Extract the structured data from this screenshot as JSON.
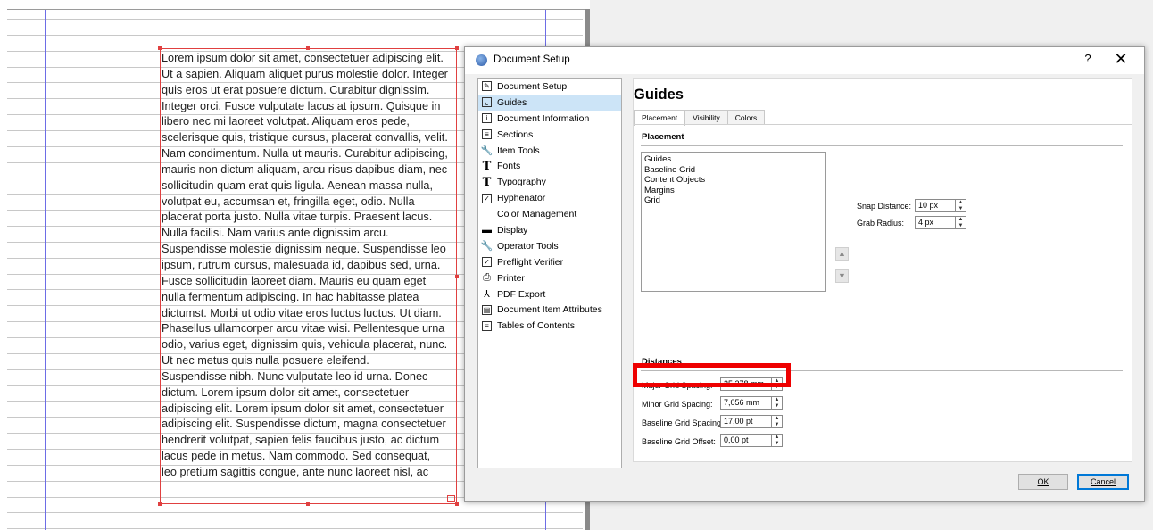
{
  "frame_text": {
    "lines": [
      "Lorem ipsum dolor sit amet, consectetuer adipiscing elit.",
      "Ut a sapien. Aliquam aliquet purus molestie dolor. Integer",
      "quis eros ut erat posuere dictum. Curabitur dignissim.",
      "Integer orci. Fusce vulputate lacus at ipsum. Quisque in",
      "libero nec mi laoreet volutpat. Aliquam eros pede,",
      "scelerisque quis, tristique cursus, placerat convallis, velit.",
      "Nam condimentum. Nulla ut mauris. Curabitur adipiscing,",
      "mauris non dictum aliquam, arcu risus dapibus diam, nec",
      "sollicitudin quam erat quis ligula. Aenean massa nulla,",
      "volutpat eu, accumsan et, fringilla eget, odio. Nulla",
      "placerat porta justo. Nulla vitae turpis. Praesent lacus.",
      "Nulla facilisi. Nam varius ante dignissim arcu.",
      "Suspendisse molestie dignissim neque. Suspendisse leo",
      "ipsum, rutrum cursus, malesuada id, dapibus sed, urna.",
      "Fusce sollicitudin laoreet diam. Mauris eu quam eget",
      "nulla fermentum adipiscing. In hac habitasse platea",
      "dictumst. Morbi ut odio vitae eros luctus luctus. Ut diam.",
      "Phasellus ullamcorper arcu vitae wisi. Pellentesque urna",
      "odio, varius eget, dignissim quis, vehicula placerat, nunc.",
      "Ut nec metus quis nulla posuere eleifend.",
      "Suspendisse nibh. Nunc vulputate leo id urna. Donec",
      "dictum. Lorem ipsum dolor sit amet, consectetuer",
      "adipiscing elit. Lorem ipsum dolor sit amet, consectetuer",
      "adipiscing elit. Suspendisse dictum, magna consectetuer",
      "hendrerit volutpat, sapien felis faucibus justo, ac dictum",
      "lacus pede in metus. Nam commodo. Sed consequat,",
      "leo pretium sagittis congue, ante nunc laoreet nisl, ac"
    ]
  },
  "dialog": {
    "title": "Document Setup",
    "help": "?",
    "close": "✕",
    "nav": [
      {
        "label": "Document Setup",
        "icon": "document-setup-icon",
        "glyph": "✎"
      },
      {
        "label": "Guides",
        "icon": "guides-icon",
        "glyph": "⌞",
        "selected": true
      },
      {
        "label": "Document Information",
        "icon": "info-icon",
        "glyph": "i"
      },
      {
        "label": "Sections",
        "icon": "sections-icon",
        "glyph": "≡"
      },
      {
        "label": "Item Tools",
        "icon": "wrench-icon",
        "glyph": "🔧"
      },
      {
        "label": "Fonts",
        "icon": "font-icon",
        "glyph": "T"
      },
      {
        "label": "Typography",
        "icon": "typography-icon",
        "glyph": "T"
      },
      {
        "label": "Hyphenator",
        "icon": "checkbox-icon",
        "glyph": "✓"
      },
      {
        "label": "Color Management",
        "icon": "color-management-icon",
        "glyph": ""
      },
      {
        "label": "Display",
        "icon": "monitor-icon",
        "glyph": "▬"
      },
      {
        "label": "Operator Tools",
        "icon": "wrench-icon",
        "glyph": "🔧"
      },
      {
        "label": "Preflight Verifier",
        "icon": "checkbox-icon",
        "glyph": "✓"
      },
      {
        "label": "Printer",
        "icon": "printer-icon",
        "glyph": "⎙"
      },
      {
        "label": "PDF Export",
        "icon": "pdf-icon",
        "glyph": "⅄"
      },
      {
        "label": "Document Item Attributes",
        "icon": "attributes-icon",
        "glyph": "▤"
      },
      {
        "label": "Tables of Contents",
        "icon": "toc-icon",
        "glyph": "≡"
      }
    ],
    "page_title": "Guides",
    "tabs": [
      "Placement",
      "Visibility",
      "Colors"
    ],
    "placement": {
      "heading": "Placement",
      "list": [
        "Guides",
        "Baseline Grid",
        "Content Objects",
        "Margins",
        "Grid"
      ],
      "up_arrow": "▲",
      "down_arrow": "▼",
      "snap_label": "Snap Distance:",
      "snap_value": "10 px",
      "grab_label": "Grab Radius:",
      "grab_value": "4 px"
    },
    "distances": {
      "heading": "Distances",
      "major_label": "Major Grid Spacing:",
      "major_value": "35,278 mm",
      "minor_label": "Minor Grid Spacing:",
      "minor_value": "7,056 mm",
      "baseline_label": "Baseline Grid Spacing:",
      "baseline_value": "17,00 pt",
      "offset_label": "Baseline Grid Offset:",
      "offset_value": "0,00 pt"
    },
    "ok": "OK",
    "cancel": "Cancel"
  },
  "colors": {
    "frame_border": "#e04040",
    "guide_line": "#6d6de6",
    "selection": "#cce4f7",
    "annotation": "#ee0000"
  }
}
